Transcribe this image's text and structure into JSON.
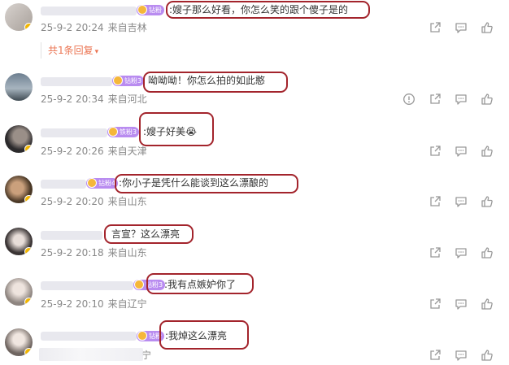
{
  "colors": {
    "highlight": "#a3242c",
    "reply_link": "#eb7350",
    "meta_text": "#888888",
    "badge": "#b98cf0"
  },
  "comments": [
    {
      "badge": "钻粉",
      "text": ":嫂子那么好看，你怎么笑的跟个傻子是的",
      "date": "25-9-2 20:24",
      "location": "来自吉林",
      "has_report": false
    },
    {
      "badge": "钻粉3",
      "text": "呦呦呦！你怎么拍的如此憨",
      "date": "25-9-2 20:34",
      "location": "来自河北",
      "has_report": true
    },
    {
      "badge": "铁粉3",
      "text": ":嫂子好美😭",
      "date": "25-9-2 20:26",
      "location": "来自天津",
      "has_report": false
    },
    {
      "badge": "钻粉4",
      "text": ":你小子是凭什么能谈到这么漂酿的",
      "date": "25-9-2 20:20",
      "location": "来自山东",
      "has_report": false
    },
    {
      "badge": "",
      "text": "言宣？这么漂亮",
      "date": "25-9-2 20:18",
      "location": "来自山东",
      "has_report": false
    },
    {
      "badge": "钻粉3",
      "text": ":我有点嫉妒你了",
      "date": "25-9-2 20:10",
      "location": "来自辽宁",
      "has_report": false
    },
    {
      "badge": "钻粉",
      "text": ":我焯这么漂亮",
      "date": "",
      "location": "宁",
      "has_report": false
    }
  ],
  "reply_toggle": {
    "label": "共1条回复",
    "arrow": "▾"
  },
  "icons": {
    "share": "share-icon",
    "comment": "comment-icon",
    "like": "like-icon",
    "report": "report-icon"
  }
}
